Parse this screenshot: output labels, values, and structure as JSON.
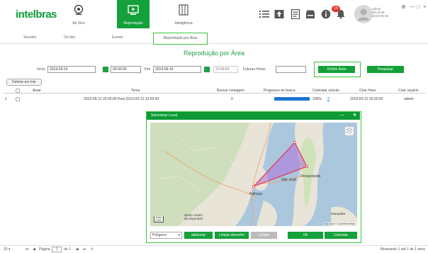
{
  "header": {
    "logo": "intelbras",
    "nav": [
      {
        "label": "Ao Vivo",
        "icon": "webcam-icon"
      },
      {
        "label": "Reprodução",
        "icon": "playback-icon"
      },
      {
        "label": "Inteligência",
        "icon": "intelligence-icon"
      }
    ],
    "tools": [
      "list-icon",
      "upload-icon",
      "document-icon",
      "storage-icon",
      "alarm-bell-icon"
    ],
    "alarm_badge": "14",
    "user": {
      "name": "admin",
      "time": "09:22:09",
      "date": "2019-09-16"
    },
    "window_controls": [
      "⊕",
      "—",
      "□",
      "×"
    ]
  },
  "tabs": [
    {
      "label": "Servidor"
    },
    {
      "label": "On-line"
    },
    {
      "label": "Evento"
    },
    {
      "label": "Reprodução por Área"
    }
  ],
  "section_title": "Reprodução por Área",
  "filters": {
    "start_label": "Início",
    "start_date": "2019-09-16",
    "start_time": "00:00:00",
    "end_label": "Fim",
    "end_date": "2019-09-16",
    "end_time": "23:59:59",
    "hours_label": "Futuras Horas",
    "define_area_label": "Definir Área",
    "search_label": "Pesquisar"
  },
  "delete_batch_label": "Deletar em lote",
  "table": {
    "headers": [
      "Atuar",
      "Tema",
      "Buscar contagem",
      "Progresso de busca",
      "Contratar veículo",
      "Criar Hora",
      "Criar usuário"
    ],
    "rows": [
      {
        "index": "1",
        "tema": "2019-09-12 20:30:00 Para 2019-09-12 23:59:59",
        "count": "0",
        "progress": "100%",
        "progress_value": 1.0,
        "vehicles": "2",
        "created": "2019-09-12 05:30:59",
        "user": "admin"
      }
    ]
  },
  "dialog": {
    "title": "Selecionar Local",
    "select_value": "Polígono",
    "buttons": {
      "add": "adicionar",
      "clear": "Limpar desenho",
      "clean": "Limpar",
      "ok": "Ok",
      "cancel": "Cancelar"
    },
    "map_labels": [
      "Florianópolis",
      "São José",
      "Palhoça",
      "Santo Amaro\nda Imperatriz",
      "Garopaba"
    ],
    "map_credit": "Map data © OpenStreetMap",
    "map_scale": [
      "5 km",
      "3 mi"
    ]
  },
  "pagination": {
    "page_size": "20",
    "page_label": "Página",
    "page_value": "1",
    "of_label": "de 1",
    "summary": "Mostrando 1 até 1 de 1 itens"
  },
  "colors": {
    "brand_green": "#0e9b3a",
    "area_fill": "#b070d8",
    "area_stroke": "#e8334a",
    "progress_blue": "#1976d2"
  }
}
